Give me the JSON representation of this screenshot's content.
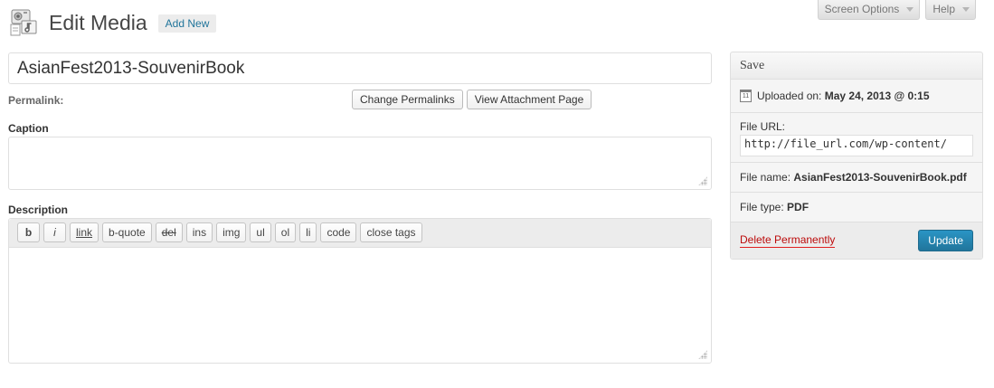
{
  "screen_meta": {
    "screen_options": "Screen Options",
    "help": "Help"
  },
  "header": {
    "title": "Edit Media",
    "add_new": "Add New"
  },
  "form": {
    "title_value": "AsianFest2013-SouvenirBook",
    "permalink_label": "Permalink:",
    "change_permalinks": "Change Permalinks",
    "view_attachment": "View Attachment Page",
    "caption_label": "Caption",
    "caption_value": "",
    "description_label": "Description",
    "description_value": "",
    "quicktags": [
      "b",
      "i",
      "link",
      "b-quote",
      "del",
      "ins",
      "img",
      "ul",
      "ol",
      "li",
      "code",
      "close tags"
    ]
  },
  "sidebar": {
    "heading": "Save",
    "uploaded_label": "Uploaded on:",
    "uploaded_value": "May 24, 2013 @ 0:15",
    "calendar_day": "11",
    "file_url_label": "File URL:",
    "file_url_value": "http://file_url.com/wp-content/",
    "file_name_label": "File name:",
    "file_name_value": "AsianFest2013-SouvenirBook.pdf",
    "file_type_label": "File type:",
    "file_type_value": "PDF",
    "delete_label": "Delete Permanently",
    "update_label": "Update"
  },
  "colors": {
    "link": "#21759b",
    "delete": "#bc0b0b",
    "primary_button": "#2a95c5"
  }
}
